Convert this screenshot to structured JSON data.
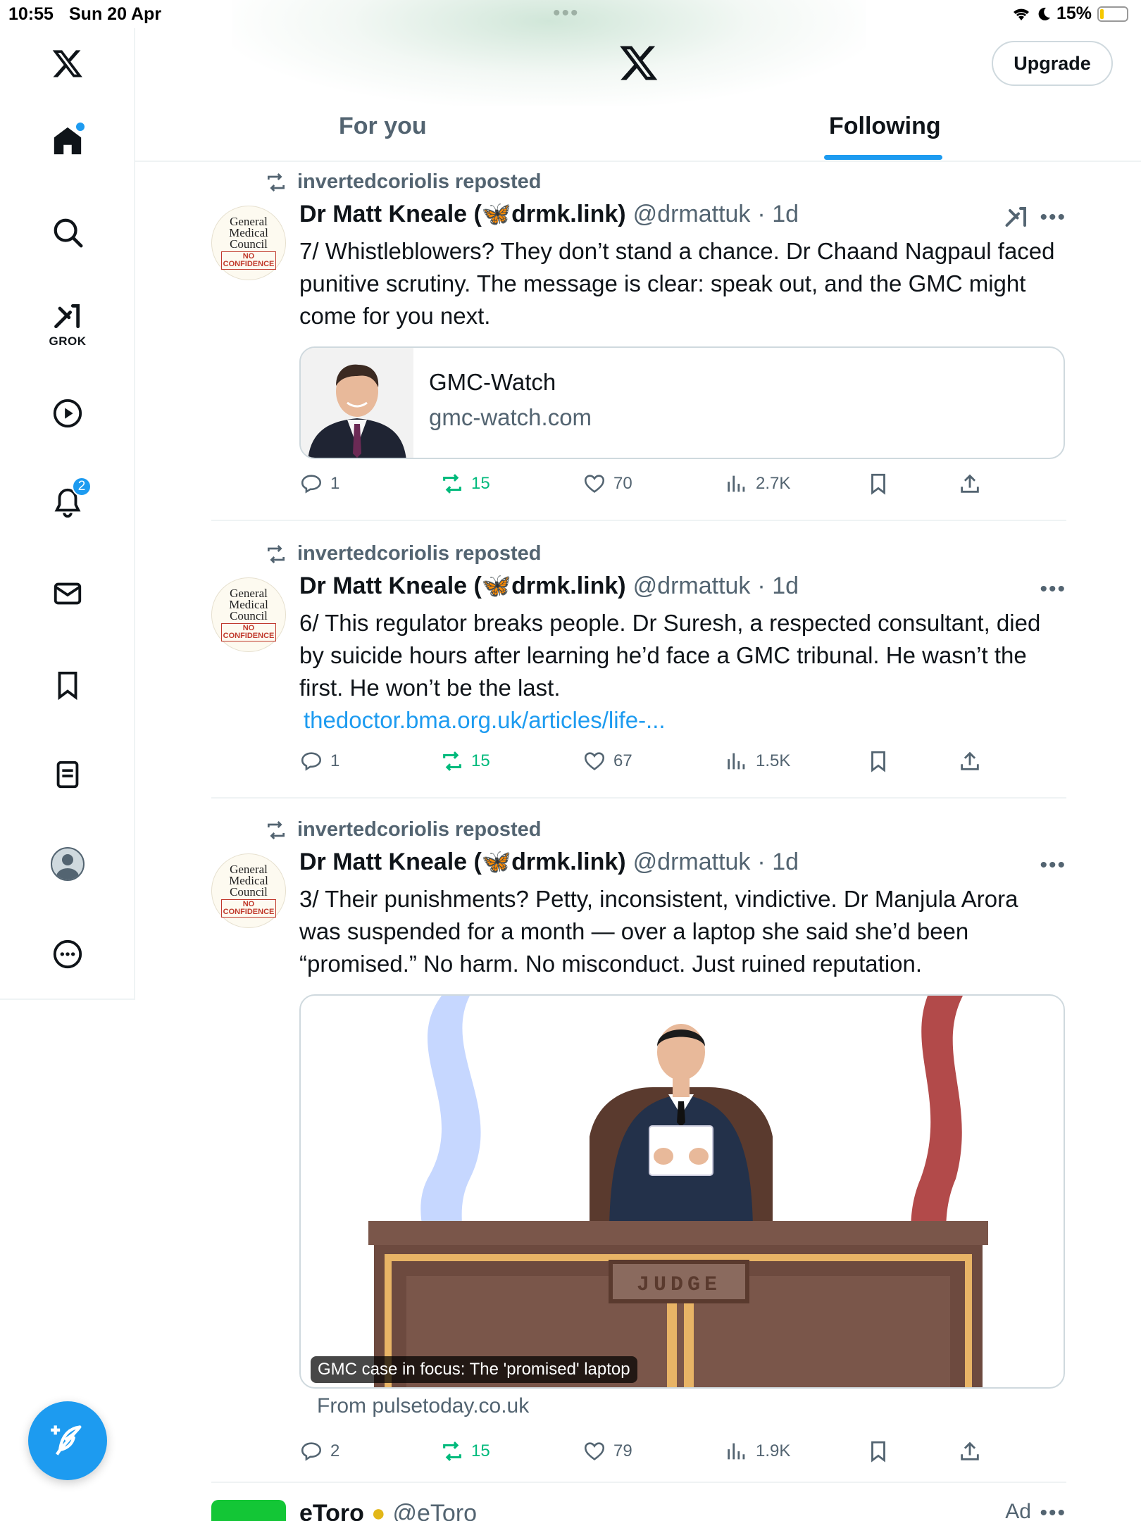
{
  "status_bar": {
    "time": "10:55",
    "date": "Sun 20 Apr",
    "battery": "15%",
    "battery_level": 0.15
  },
  "header": {
    "upgrade_label": "Upgrade"
  },
  "tabs": [
    {
      "label": "For you",
      "active": false
    },
    {
      "label": "Following",
      "active": true
    }
  ],
  "sidebar": {
    "grok_label": "GROK",
    "notifications_badge": "2",
    "items": [
      "x-logo",
      "home-icon",
      "search-icon",
      "grok-icon",
      "video-icon",
      "bell-icon",
      "mail-icon",
      "bookmark-icon",
      "lists-icon",
      "profile-icon",
      "more-icon"
    ]
  },
  "posts": [
    {
      "repost_text": "invertedcoriolis reposted",
      "name": "Dr Matt Kneale (🦋drmk.link)",
      "handle": "@drmattuk",
      "time": "· 1d",
      "text": "7/ Whistleblowers? They don’t stand a chance. Dr Chaand Nagpaul faced punitive scrutiny. The message is clear: speak out, and the GMC might come for you next.",
      "card": {
        "title": "GMC-Watch",
        "domain": "gmc-watch.com"
      },
      "replies": "1",
      "reposts": "15",
      "likes": "70",
      "views": "2.7K"
    },
    {
      "repost_text": "invertedcoriolis reposted",
      "name": "Dr Matt Kneale (🦋drmk.link)",
      "handle": "@drmattuk",
      "time": "· 1d",
      "text": "6/ This regulator breaks people. Dr Suresh, a respected consultant, died by suicide hours after learning he’d face a GMC tribunal. He wasn’t the first. He won’t be the last.",
      "link": "thedoctor.bma.org.uk/articles/life-...",
      "replies": "1",
      "reposts": "15",
      "likes": "67",
      "views": "1.5K"
    },
    {
      "repost_text": "invertedcoriolis reposted",
      "name": "Dr Matt Kneale (🦋drmk.link)",
      "handle": "@drmattuk",
      "time": "· 1d",
      "text": "3/ Their punishments? Petty, inconsistent, vindictive. Dr Manjula Arora was suspended for a month — over a laptop she said she’d been “promised.” No harm. No misconduct. Just ruined reputation.",
      "media_caption": "GMC case in focus: The 'promised' laptop",
      "media_sign": "JUDGE",
      "from": "From pulsetoday.co.uk",
      "replies": "2",
      "reposts": "15",
      "likes": "79",
      "views": "1.9K"
    }
  ],
  "ad_post": {
    "name": "eToro",
    "handle": "@eToro",
    "ad_label": "Ad"
  },
  "avatar_text": {
    "line1": "General",
    "line2": "Medical",
    "line3": "Council",
    "badge1": "NO",
    "badge2": "CONFIDENCE"
  },
  "colors": {
    "accent": "#1d9bf0",
    "repost_green": "#00ba7c",
    "text": "#0f1419",
    "muted": "#536471"
  }
}
